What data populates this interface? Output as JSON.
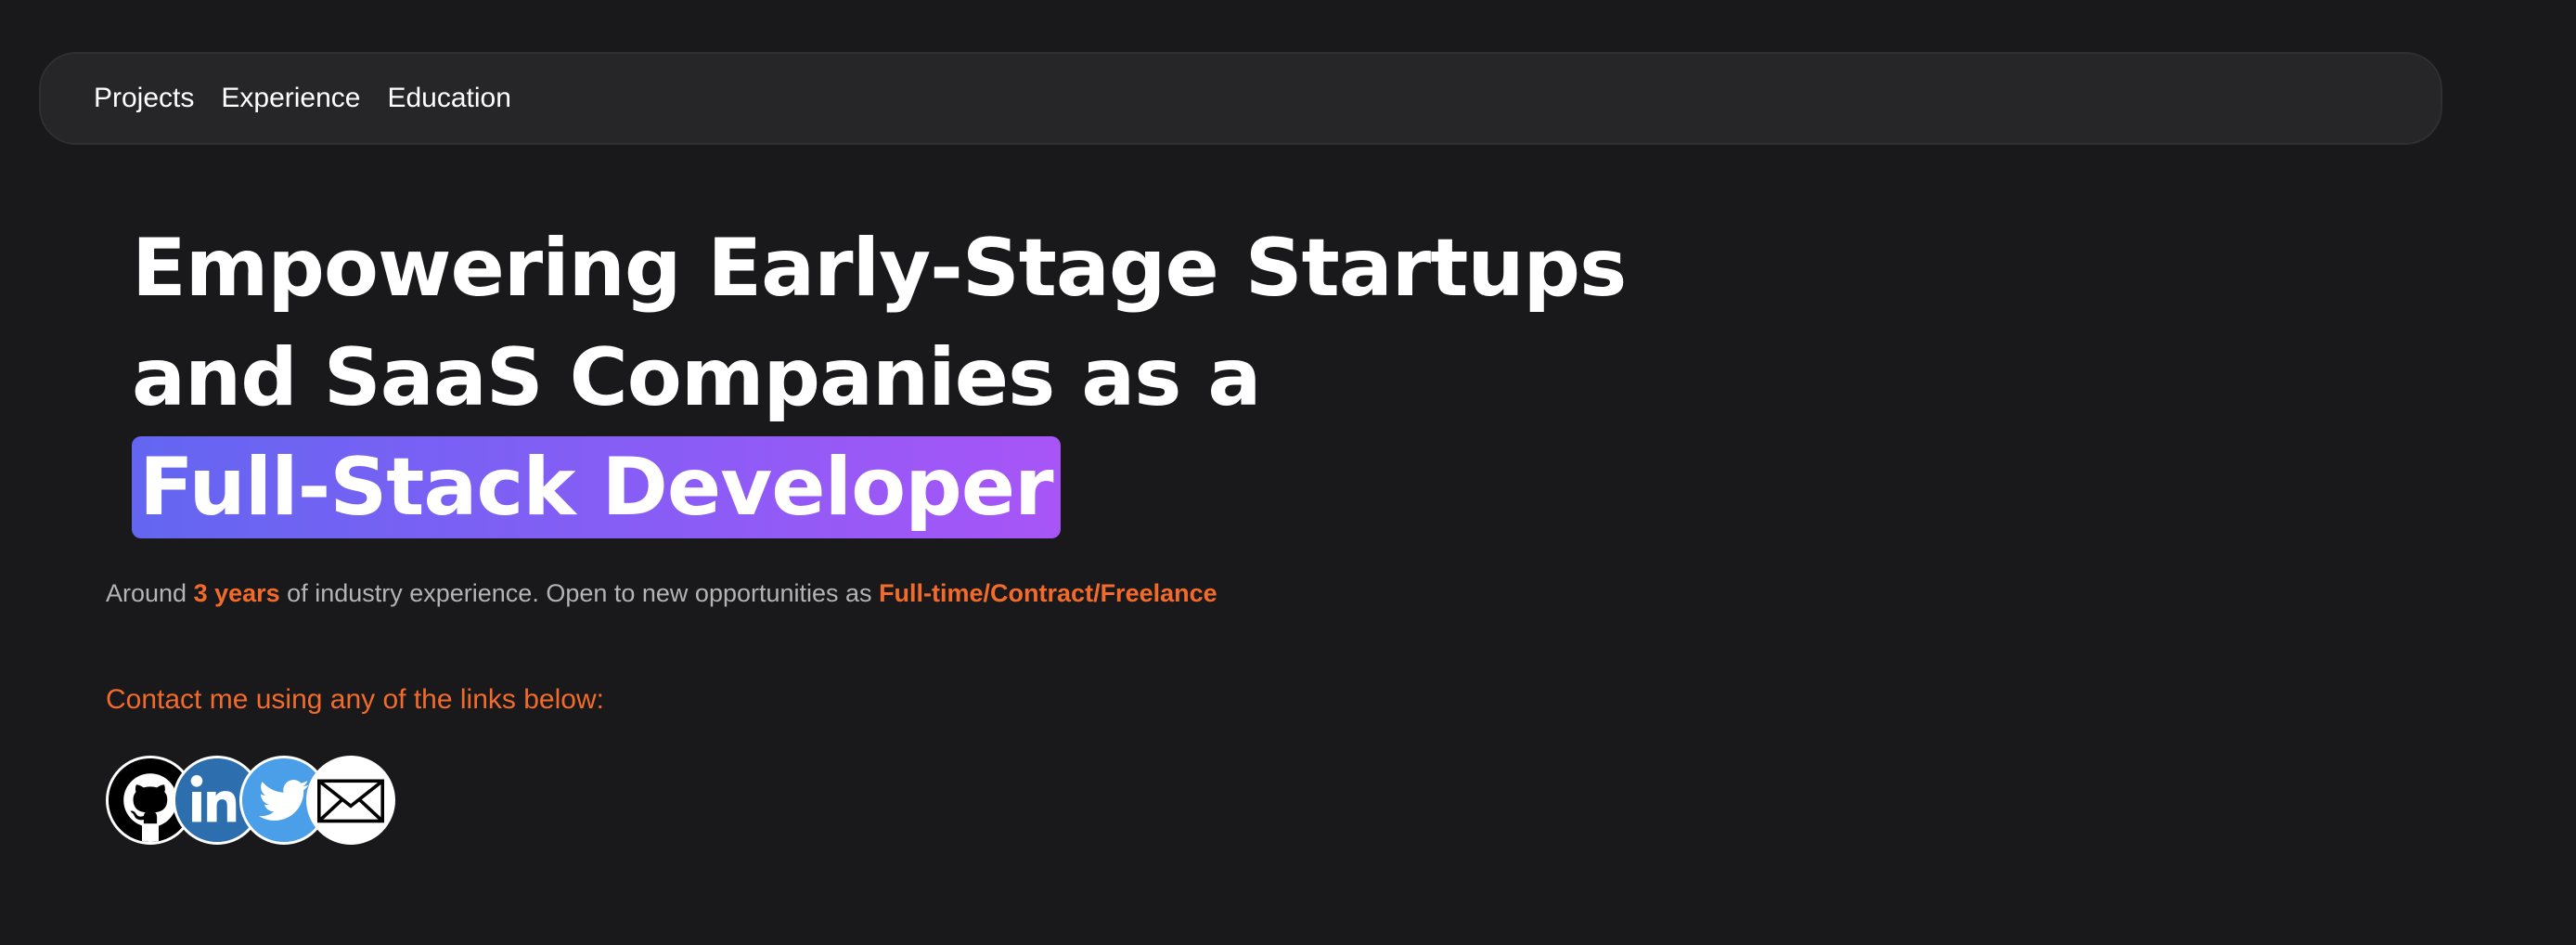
{
  "nav": {
    "items": [
      {
        "label": "Projects"
      },
      {
        "label": "Experience"
      },
      {
        "label": "Education"
      }
    ]
  },
  "hero": {
    "line1": "Empowering Early-Stage Startups",
    "line2": "and SaaS Companies as a",
    "highlight": "Full-Stack Developer"
  },
  "summary": {
    "prefix": "Around ",
    "years": "3 years",
    "middle": " of industry experience. Open to new opportunities as ",
    "roles": "Full-time/Contract/Freelance"
  },
  "contact": {
    "prompt": "Contact me using any of the links below:"
  },
  "socials": [
    {
      "icon": "github-icon",
      "color": "#000000"
    },
    {
      "icon": "linkedin-icon",
      "color": "#2d6eaf"
    },
    {
      "icon": "twitter-icon",
      "color": "#4a9fe8"
    },
    {
      "icon": "email-icon",
      "color": "#000000"
    }
  ],
  "colors": {
    "background": "#19191c",
    "navbar": "#262628",
    "accent": "#f26b2a",
    "highlight_start": "#6366f1",
    "highlight_end": "#a855f7"
  }
}
